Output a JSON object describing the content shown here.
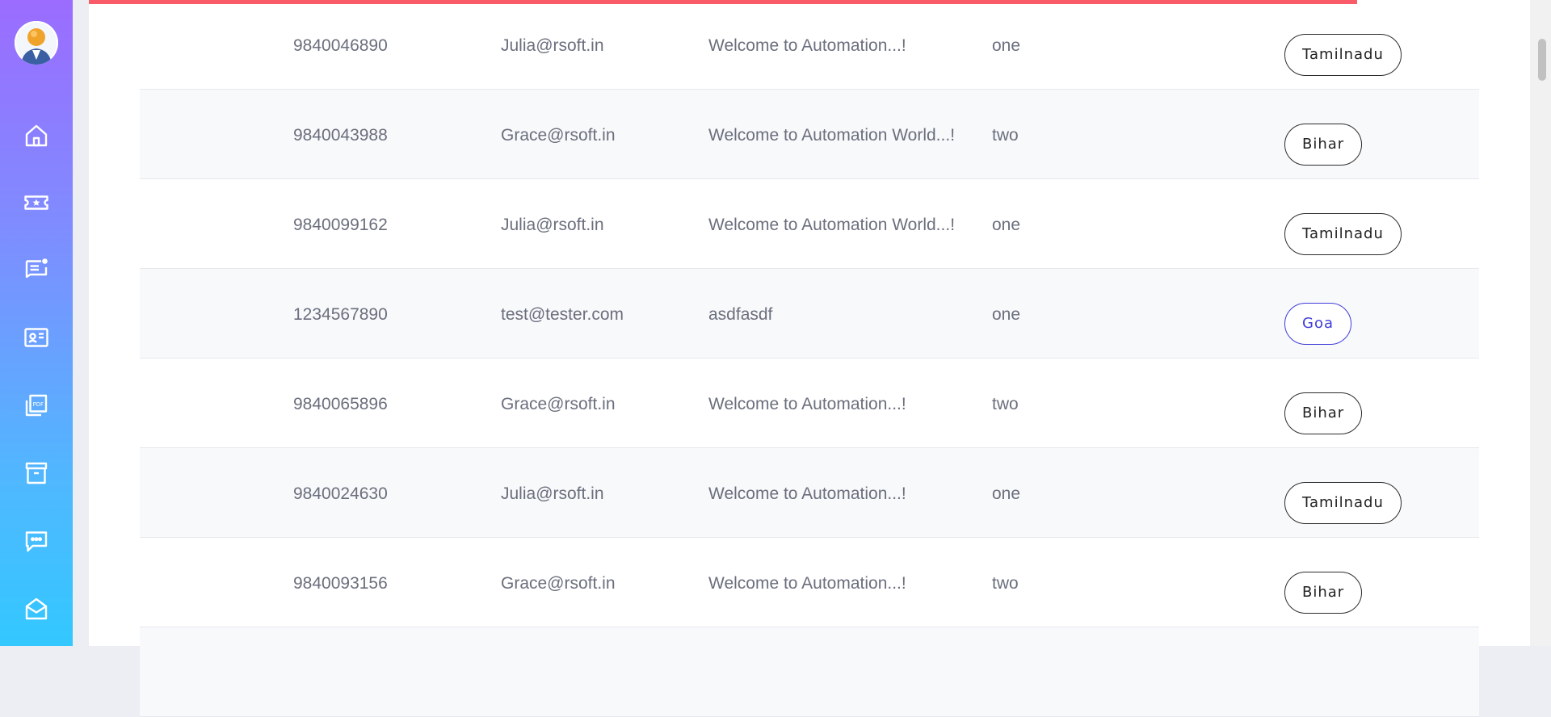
{
  "page": {
    "accent_color": "#f95b68",
    "active_pill_color": "#3f3cd9",
    "page_load_progress_percent": 88
  },
  "sidebar": {
    "avatar_icon": "user-avatar",
    "items": [
      {
        "icon": "home-icon"
      },
      {
        "icon": "ticket-star-icon"
      },
      {
        "icon": "notes-notification-icon"
      },
      {
        "icon": "contact-card-icon"
      },
      {
        "icon": "pdf-files-icon"
      },
      {
        "icon": "archive-box-icon"
      },
      {
        "icon": "chat-bubble-icon"
      },
      {
        "icon": "open-mail-icon"
      }
    ]
  },
  "table": {
    "rows": [
      {
        "phone": "9840046890",
        "email": "Julia@rsoft.in",
        "message": "Welcome to Automation...!",
        "number": "one",
        "state": "Tamilnadu"
      },
      {
        "phone": "9840043988",
        "email": "Grace@rsoft.in",
        "message": "Welcome to Automation World...!",
        "number": "two",
        "state": "Bihar"
      },
      {
        "phone": "9840099162",
        "email": "Julia@rsoft.in",
        "message": "Welcome to Automation World...!",
        "number": "one",
        "state": "Tamilnadu"
      },
      {
        "phone": "1234567890",
        "email": "test@tester.com",
        "message": "asdfasdf",
        "number": "one",
        "state": "Goa"
      },
      {
        "phone": "9840065896",
        "email": "Grace@rsoft.in",
        "message": "Welcome to Automation...!",
        "number": "two",
        "state": "Bihar"
      },
      {
        "phone": "9840024630",
        "email": "Julia@rsoft.in",
        "message": "Welcome to Automation...!",
        "number": "one",
        "state": "Tamilnadu"
      },
      {
        "phone": "9840093156",
        "email": "Grace@rsoft.in",
        "message": "Welcome to Automation...!",
        "number": "two",
        "state": "Bihar"
      },
      {
        "phone": "",
        "email": "",
        "message": "",
        "number": "",
        "state": ""
      }
    ]
  }
}
